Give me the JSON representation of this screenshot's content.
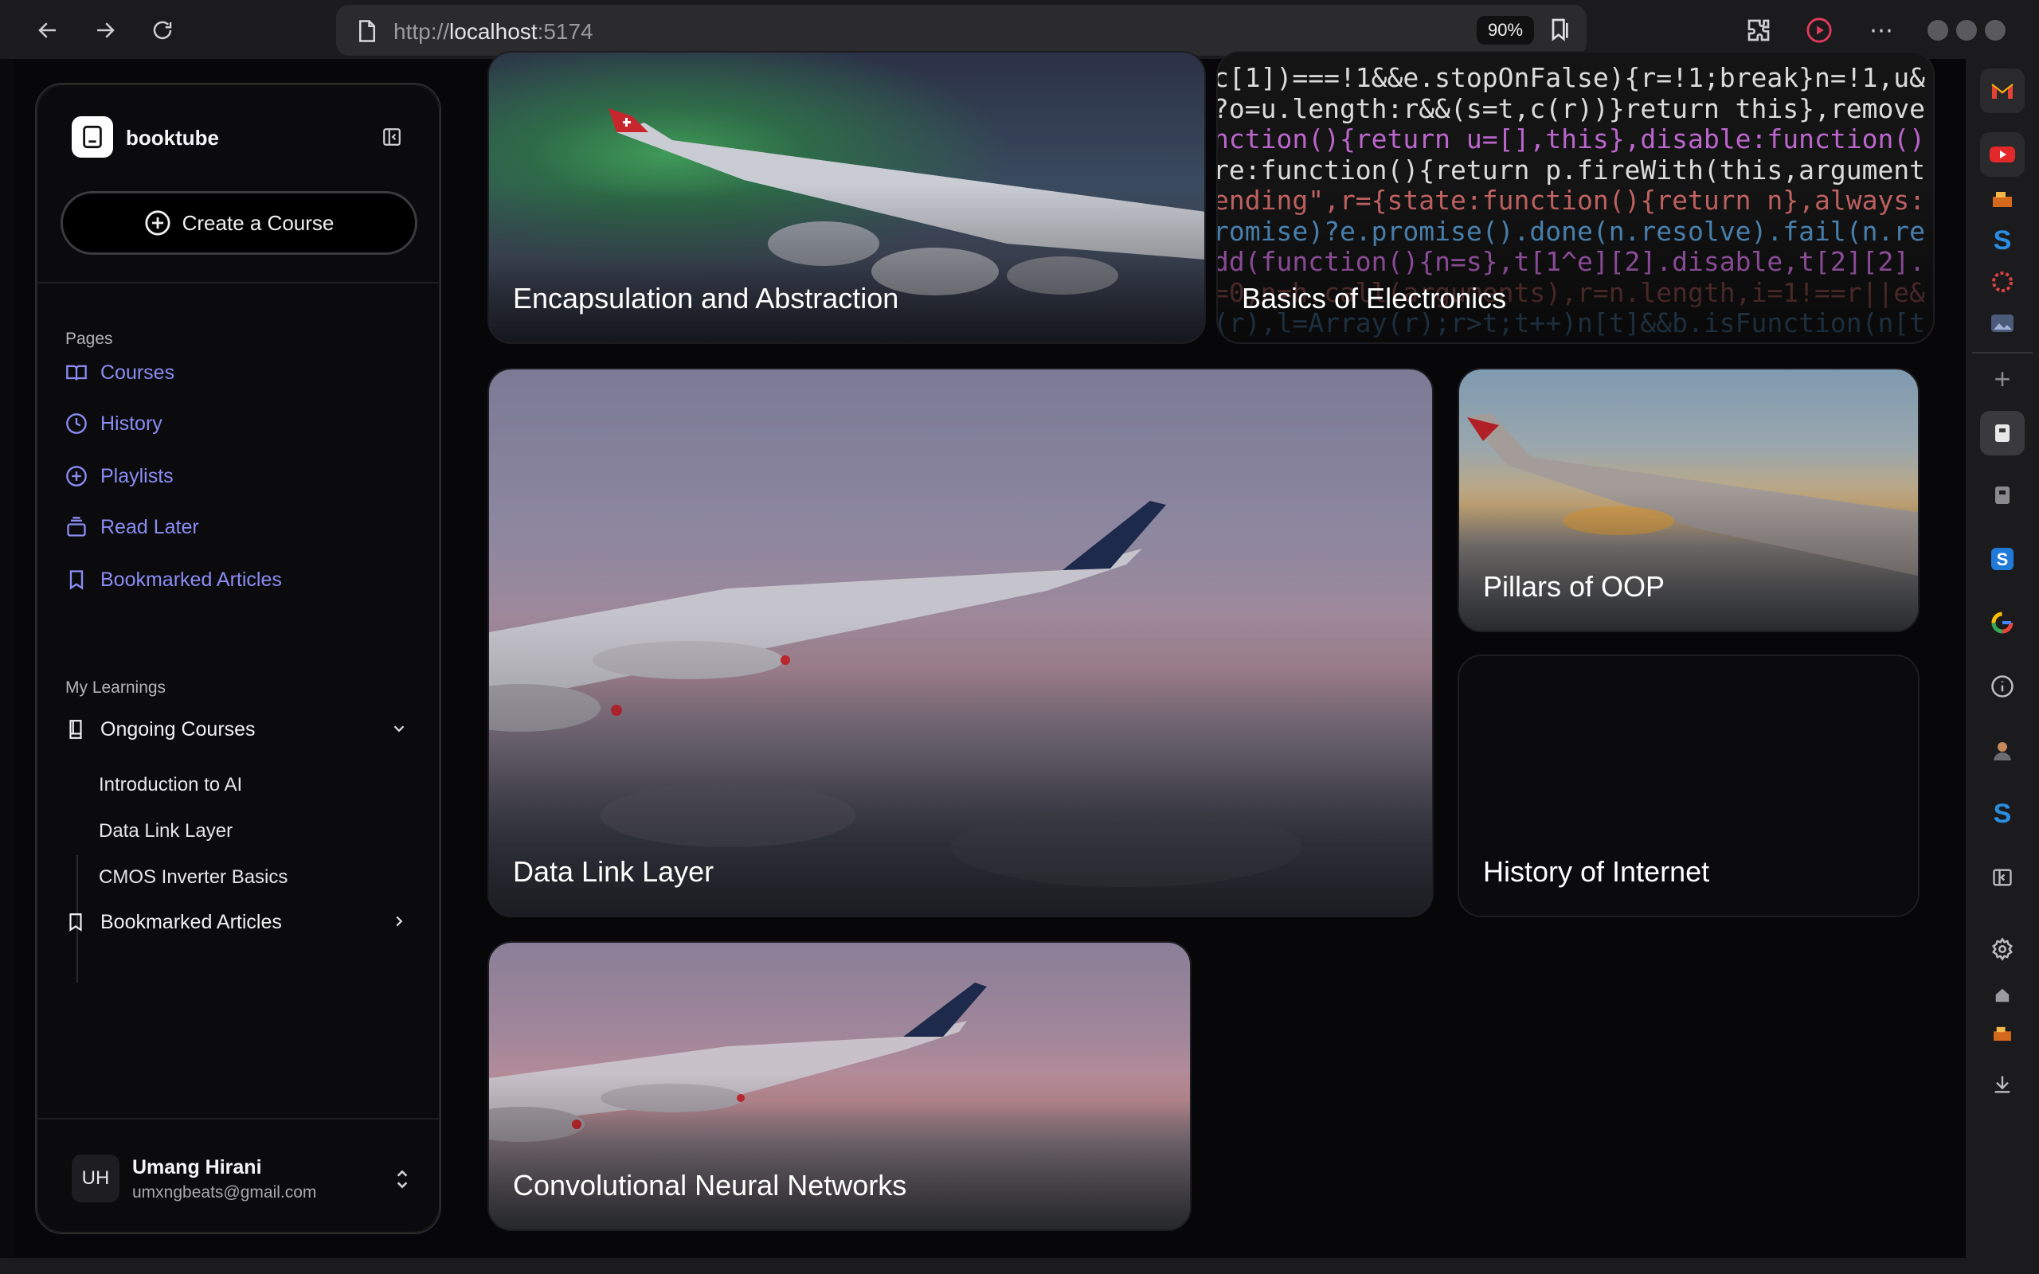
{
  "browser": {
    "url_prefix": "http://",
    "url_host": "localhost",
    "url_suffix": ":5174",
    "zoom": "90%"
  },
  "sidebar": {
    "brand": "booktube",
    "create_label": "Create a Course",
    "pages_label": "Pages",
    "pages": [
      {
        "label": "Courses",
        "icon": "book-open-icon"
      },
      {
        "label": "History",
        "icon": "clock-icon"
      },
      {
        "label": "Playlists",
        "icon": "plus-circle-icon"
      },
      {
        "label": "Read Later",
        "icon": "stack-icon"
      },
      {
        "label": "Bookmarked Articles",
        "icon": "bookmark-icon"
      }
    ],
    "learnings_label": "My Learnings",
    "ongoing_label": "Ongoing Courses",
    "ongoing_items": [
      "Introduction to AI",
      "Data Link Layer",
      "CMOS Inverter Basics"
    ],
    "bookmarked_label": "Bookmarked Articles",
    "user": {
      "initials": "UH",
      "name": "Umang Hirani",
      "email": "umxngbeats@gmail.com"
    }
  },
  "courses": [
    {
      "title": "Encapsulation and Abstraction"
    },
    {
      "title": "Basics of Electronics"
    },
    {
      "title": "Data Link Layer"
    },
    {
      "title": "Pillars of OOP"
    },
    {
      "title": "History of Internet"
    },
    {
      "title": "Convolutional Neural Networks"
    }
  ],
  "code_lines": [
    "c[1])===!1&&e.stopOnFalse){r=!1;break}n=!1,u&",
    "?o=u.length:r&&(s=t,c(r))}return this},remove",
    "nction(){return u=[],this},disable:function()",
    "re:function(){return p.fireWith(this,argument",
    "ending\",r={state:function(){return n},always:",
    "romise)?e.promise().done(n.resolve).fail(n.re",
    "dd(function(){n=s},t[1^e][2].disable,t[2][2].",
    "=0,n=h.call(arguments),r=n.length,i=1!==r||e&",
    "(r),l=Array(r);r>t;t++)n[t]&&b.isFunction(n[t"
  ],
  "colors": {
    "accent": "#8b8cf5",
    "background": "#070709",
    "sidebar_bg": "#0b0b0d"
  }
}
